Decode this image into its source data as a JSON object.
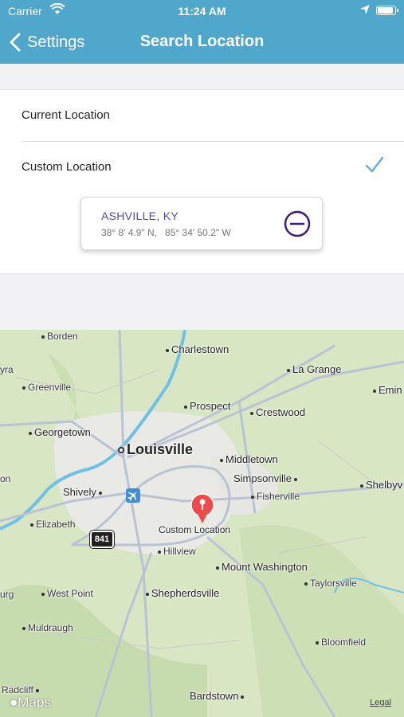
{
  "status_bar": {
    "carrier": "Carrier",
    "time": "11:24 AM",
    "icons": [
      "wifi-icon",
      "location-arrow-icon",
      "battery-icon"
    ]
  },
  "nav": {
    "back_label": "Settings",
    "title": "Search Location",
    "back_icon": "chevron-left-icon"
  },
  "options": {
    "current_label": "Current Location",
    "custom_label": "Custom Location",
    "selected": "custom",
    "check_icon": "checkmark-icon"
  },
  "location_card": {
    "name": "ASHVILLE, KY",
    "coords": "38° 8' 4.9\" N,   85° 34' 50.2\" W",
    "remove_icon": "minus-circle-icon"
  },
  "map": {
    "places": {
      "borden": "Borden",
      "charlestown": "Charlestown",
      "yra": "yra",
      "la_grange": "La Grange",
      "greenville": "Greenville",
      "emin": "Emin",
      "prospect": "Prospect",
      "crestwood": "Crestwood",
      "georgetown": "Georgetown",
      "louisville": "Louisville",
      "middletown": "Middletown",
      "on": "on",
      "simpsonville": "Simpsonville",
      "shelbyv": "Shelbyv",
      "shively": "Shively",
      "fisherville": "Fisherville",
      "elizabeth": "Elizabeth",
      "hillview": "Hillview",
      "mount_washington": "Mount Washington",
      "taylorsville": "Taylorsville",
      "urg": "urg",
      "west_point": "West Point",
      "shepherdsville": "Shepherdsville",
      "muldraugh": "Muldraugh",
      "bloomfield": "Bloomfield",
      "radcliff": "Radcliff",
      "bardstown": "Bardstown"
    },
    "pin_label": "Custom Location",
    "route_number": "841",
    "brand": "Maps",
    "legal": "Legal",
    "colors": {
      "land": "#d8e6c4",
      "urban": "#e9e9e6",
      "water": "#6fc0e8",
      "roads": "#b9c3d4",
      "pin": "#f0494a"
    }
  }
}
